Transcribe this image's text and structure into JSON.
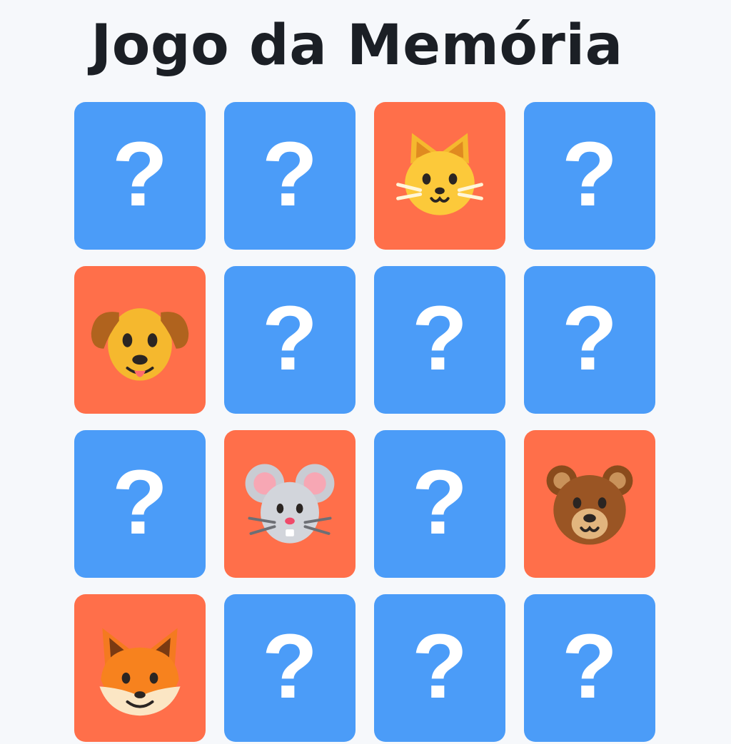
{
  "game": {
    "title": "Jogo da Memória"
  },
  "cards": [
    {
      "state": "hidden",
      "symbol": "?"
    },
    {
      "state": "hidden",
      "symbol": "?"
    },
    {
      "state": "revealed",
      "animal": "cat-icon"
    },
    {
      "state": "hidden",
      "symbol": "?"
    },
    {
      "state": "revealed",
      "animal": "dog-icon"
    },
    {
      "state": "hidden",
      "symbol": "?"
    },
    {
      "state": "hidden",
      "symbol": "?"
    },
    {
      "state": "hidden",
      "symbol": "?"
    },
    {
      "state": "hidden",
      "symbol": "?"
    },
    {
      "state": "revealed",
      "animal": "mouse-icon"
    },
    {
      "state": "hidden",
      "symbol": "?"
    },
    {
      "state": "revealed",
      "animal": "bear-icon"
    },
    {
      "state": "revealed",
      "animal": "fox-icon"
    },
    {
      "state": "hidden",
      "symbol": "?"
    },
    {
      "state": "hidden",
      "symbol": "?"
    },
    {
      "state": "hidden",
      "symbol": "?"
    }
  ],
  "colors": {
    "background": "#f6f8fb",
    "card_hidden": "#4b9cf8",
    "card_revealed": "#ff6f4a",
    "title": "#1b1f25"
  }
}
